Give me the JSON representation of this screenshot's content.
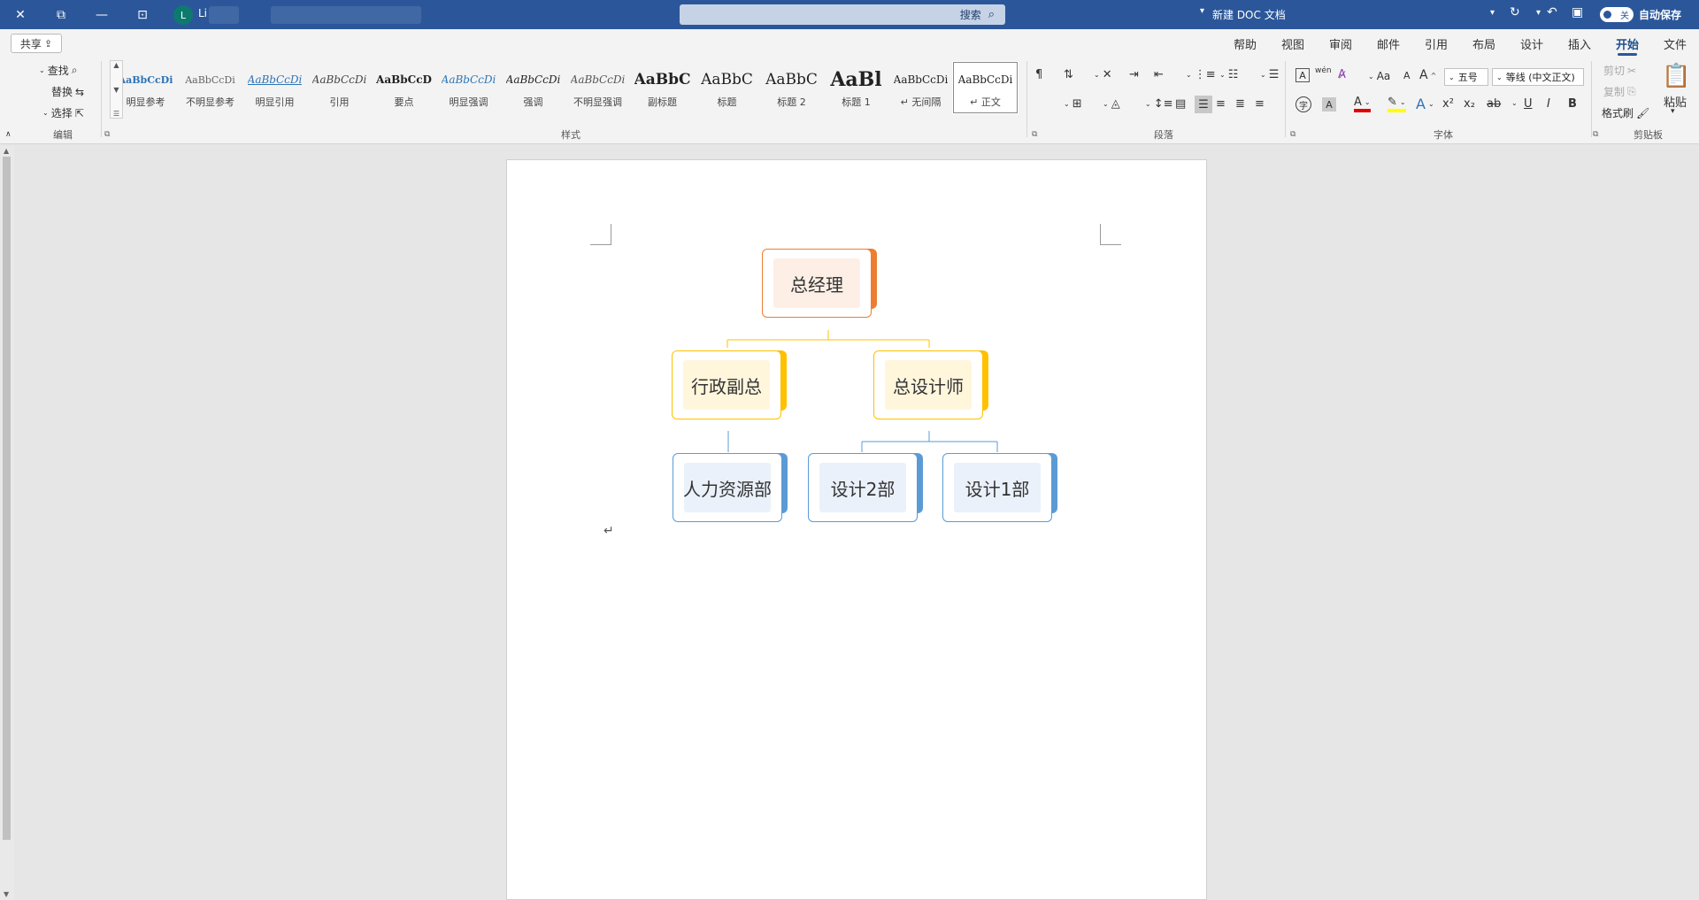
{
  "titlebar": {
    "autosave_label": "自动保存",
    "autosave_state": "关",
    "doc_title": "新建 DOC 文档",
    "search_label": "搜索",
    "user_initial": "L",
    "user_name": "Li"
  },
  "tabs": [
    {
      "label": "文件"
    },
    {
      "label": "开始",
      "active": true
    },
    {
      "label": "插入"
    },
    {
      "label": "设计"
    },
    {
      "label": "布局"
    },
    {
      "label": "引用"
    },
    {
      "label": "邮件"
    },
    {
      "label": "审阅"
    },
    {
      "label": "视图"
    },
    {
      "label": "帮助"
    }
  ],
  "share_label": "共享",
  "ribbon": {
    "clipboard": {
      "group": "剪贴板",
      "paste": "粘贴",
      "cut": "剪切",
      "copy": "复制",
      "format_painter": "格式刷"
    },
    "font": {
      "group": "字体",
      "font_name": "等线 (中文正文)",
      "font_size": "五号",
      "bold": "B",
      "italic": "I",
      "underline": "U",
      "strike": "ab",
      "sub": "x₂",
      "sup": "x²",
      "change_case": "Aa",
      "grow": "A",
      "shrink": "A",
      "wen": "wén",
      "font_color": "A",
      "highlight": "✎",
      "char_border": "A",
      "char_shade": "A",
      "text_effects": "A",
      "enclose": "字"
    },
    "paragraph": {
      "group": "段落"
    },
    "styles": {
      "group": "样式",
      "items": [
        {
          "sample": "AaBbCcDi",
          "name": "↵ 正文",
          "selected": true
        },
        {
          "sample": "AaBbCcDi",
          "name": "↵ 无间隔"
        },
        {
          "sample": "AaBl",
          "name": "标题 1"
        },
        {
          "sample": "AaBbC",
          "name": "标题 2"
        },
        {
          "sample": "AaBbC",
          "name": "标题"
        },
        {
          "sample": "AaBbC",
          "name": "副标题"
        },
        {
          "sample": "AaBbCcDi",
          "name": "不明显强调"
        },
        {
          "sample": "AaBbCcDi",
          "name": "强调"
        },
        {
          "sample": "AaBbCcDi",
          "name": "明显强调"
        },
        {
          "sample": "AaBbCcD",
          "name": "要点"
        },
        {
          "sample": "AaBbCcDi",
          "name": "引用"
        },
        {
          "sample": "AaBbCcDi",
          "name": "明显引用"
        },
        {
          "sample": "AaBbCcDi",
          "name": "不明显参考"
        },
        {
          "sample": "AaBbCcDi",
          "name": "明显参考"
        }
      ]
    },
    "editing": {
      "group": "编辑",
      "find": "查找",
      "replace": "替换",
      "select": "选择"
    }
  },
  "chart": {
    "root": "总经理",
    "level2": [
      "总设计师",
      "行政副总"
    ],
    "level3": [
      "设计1部",
      "设计2部",
      "人力资源部"
    ]
  },
  "colors": {
    "accent": "#2b579a",
    "orange": "#ed7d31",
    "gold": "#ffc000",
    "blue": "#5b9bd5"
  }
}
